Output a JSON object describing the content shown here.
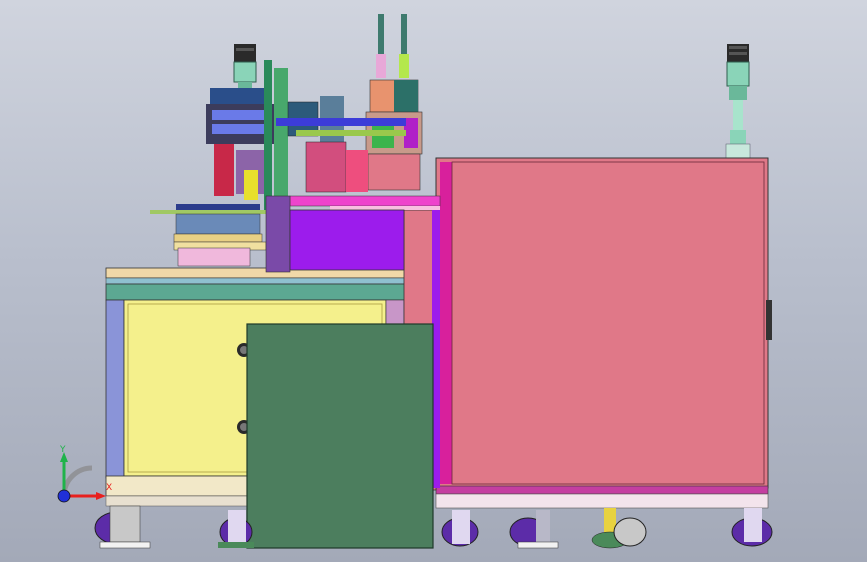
{
  "window": {
    "title": ""
  },
  "viewport": {
    "background_top": "#d0d4de",
    "background_bottom": "#a3a9b8"
  },
  "triad": {
    "y_label": "Y",
    "x_label": "X",
    "y_color": "#1fb34a",
    "x_color": "#e8201e",
    "z_color": "#2030d8"
  },
  "model": {
    "cabinet_color": "#e07888",
    "cabinet_trim_color": "#d8209c",
    "yellow_panel_color": "#f4f08c",
    "green_door_color": "#4c7e5e",
    "teal_band_color": "#5ca892",
    "violet_block_color": "#9c1cec",
    "caster_color": "#5c2ca8",
    "signal_tower_color": "#8ad4b8"
  }
}
